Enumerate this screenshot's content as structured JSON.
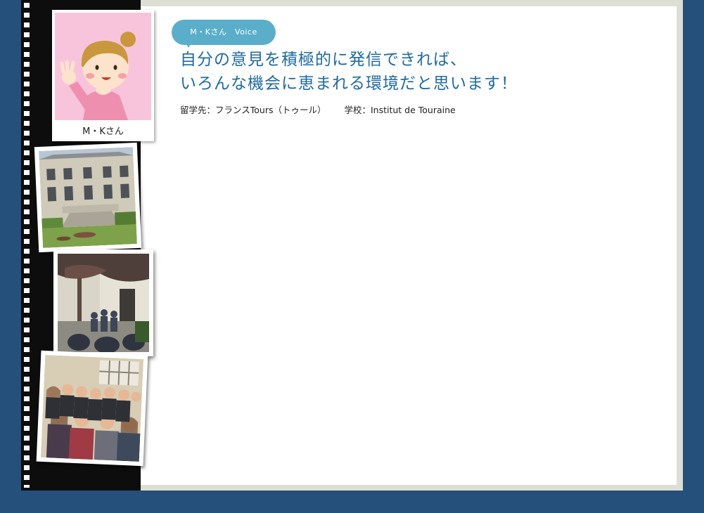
{
  "avatar": {
    "name": "M・Kさん"
  },
  "bubble": {
    "label": "M・Kさん　Voice"
  },
  "headline": {
    "line1": "自分の意見を積極的に発信できれば、",
    "line2": "いろんな機会に恵まれる環境だと思います！"
  },
  "meta": {
    "destination": "留学先：フランスTours（トゥール）",
    "school": "学校：Institut de Touraine"
  },
  "colors": {
    "navy_background": "#25507c",
    "headline_blue": "#1f6aa3",
    "bubble_blue": "#5aaec9",
    "avatar_pink": "#f8c4dc",
    "film_black": "#0d0d0d"
  }
}
